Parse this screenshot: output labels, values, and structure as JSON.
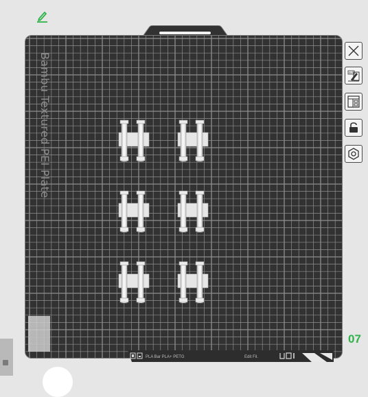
{
  "plate": {
    "label": "Bambu Textured PEI Plate",
    "number": "07"
  },
  "toolbar": {
    "items": [
      {
        "name": "close",
        "icon": "close-icon"
      },
      {
        "name": "auto-orient",
        "icon": "auto-orient-icon"
      },
      {
        "name": "arrange",
        "icon": "arrange-icon"
      },
      {
        "name": "lock",
        "icon": "lock-icon"
      },
      {
        "name": "settings",
        "icon": "settings-icon"
      }
    ]
  },
  "status_strip": {
    "left_text": "PLA Bar PLA+ PETG",
    "right_text": "Edit Fil."
  },
  "colors": {
    "plate_bg": "#323232",
    "grid_line": "#8f8f8f",
    "accent_green": "#2fb34a",
    "part": "#e6e6e6"
  }
}
